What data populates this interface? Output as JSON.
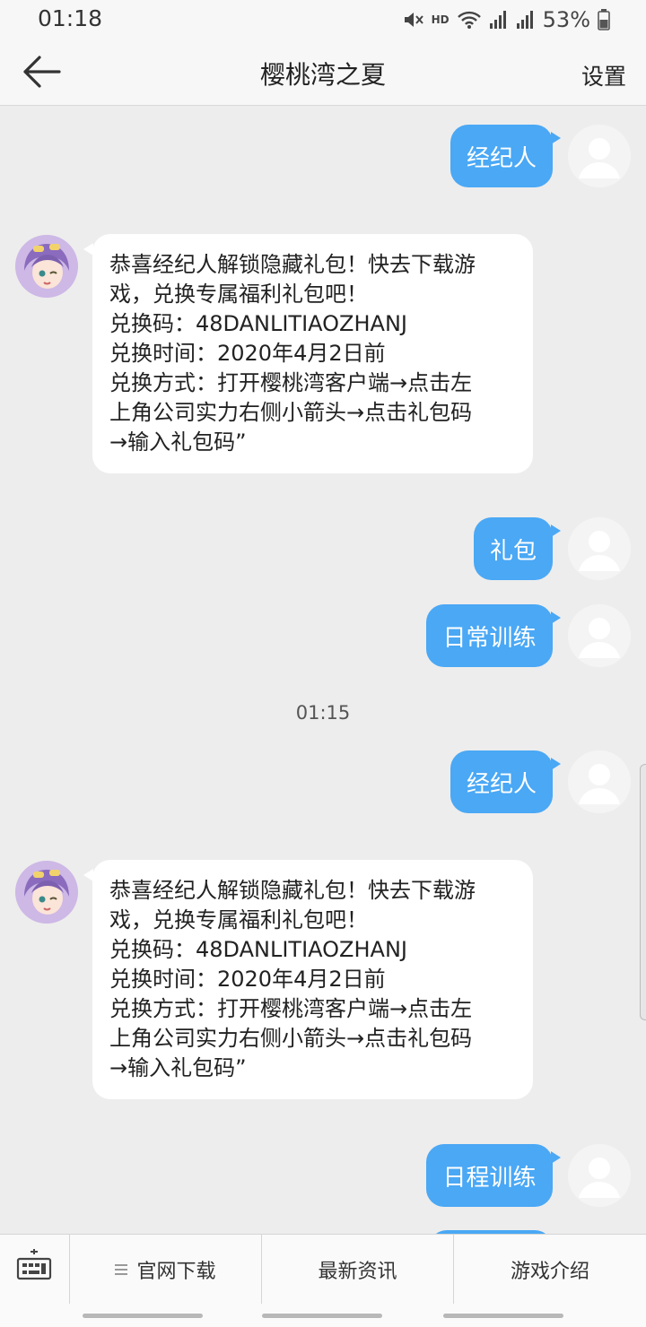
{
  "status_bar": {
    "time": "01:18",
    "hd_label": "HD",
    "battery": "53%"
  },
  "header": {
    "title": "樱桃湾之夏",
    "settings_label": "设置"
  },
  "messages": {
    "m1": "经纪人",
    "m2": [
      "恭喜经纪人解锁隐藏礼包！快去下载游",
      "戏，兑换专属福利礼包吧！",
      "兑换码：48DANLITIAOZHANJ",
      "兑换时间：2020年4月2日前",
      "兑换方式：打开樱桃湾客户端→点击左",
      "上角公司实力右侧小箭头→点击礼包码",
      "→输入礼包码”"
    ],
    "m3": "礼包",
    "m4": "日常训练",
    "time_separator": "01:15",
    "m5": "经纪人",
    "m6": [
      "恭喜经纪人解锁隐藏礼包！快去下载游",
      "戏，兑换专属福利礼包吧！",
      "兑换码：48DANLITIAOZHANJ",
      "兑换时间：2020年4月2日前",
      "兑换方式：打开樱桃湾客户端→点击左",
      "上角公司实力右侧小箭头→点击礼包码",
      "→输入礼包码”"
    ],
    "m7": "日程训练"
  },
  "bottom_menu": {
    "items": [
      "官网下载",
      "最新资讯",
      "游戏介绍"
    ]
  },
  "colors": {
    "user_bubble": "#4aa8f5",
    "bot_bubble": "#ffffff",
    "background": "#ededed"
  },
  "icons": [
    "back-arrow-icon",
    "keyboard-icon",
    "menu-lines-icon",
    "user-avatar-icon",
    "bot-avatar-icon"
  ]
}
